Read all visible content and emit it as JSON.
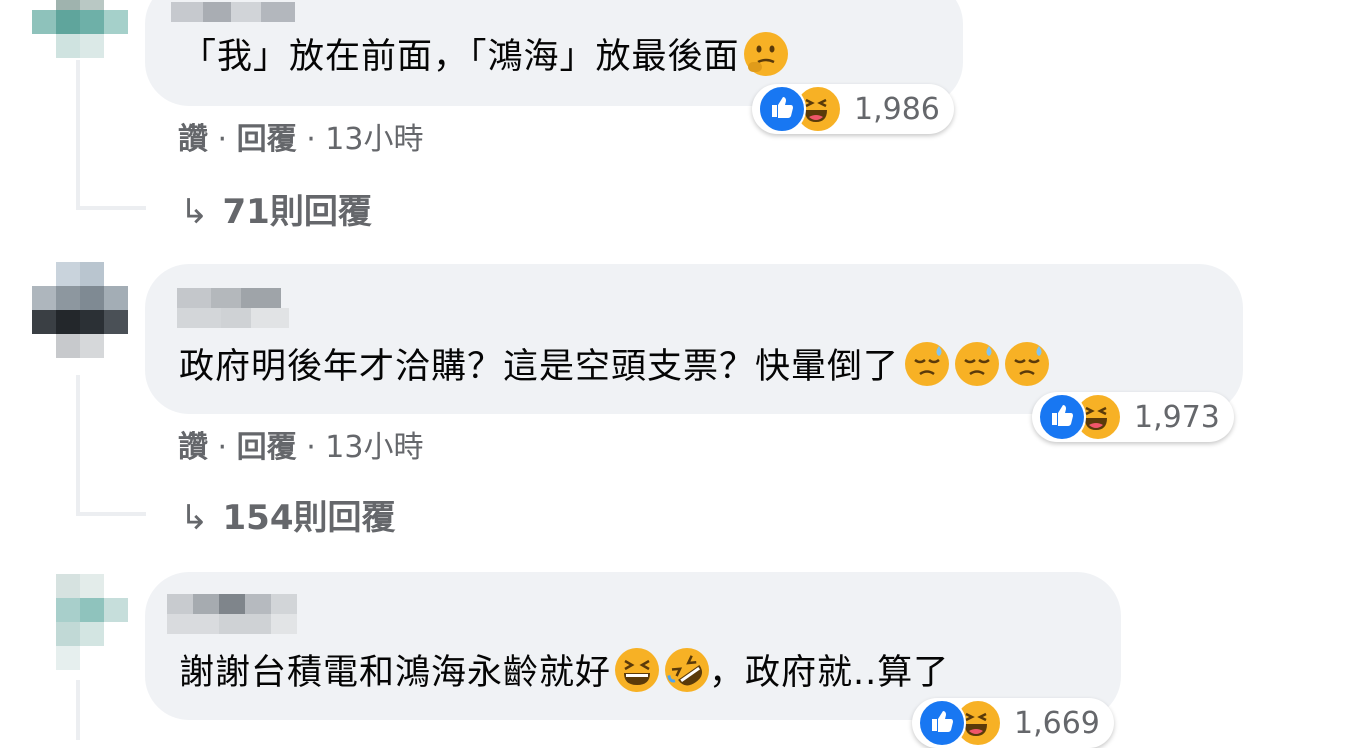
{
  "comments": [
    {
      "text": "「我」放在前面，「鴻海」放最後面",
      "emoji": [
        "thinking-face"
      ],
      "reactions": {
        "icons": [
          "like",
          "haha"
        ],
        "count": "1,986"
      },
      "meta": {
        "like": "讚",
        "sep1": "·",
        "reply": "回覆",
        "sep2": "·",
        "time": "13小時"
      },
      "replies": "71則回覆"
    },
    {
      "text": "政府明後年才洽購？這是空頭支票？快暈倒了",
      "emoji": [
        "sweat-face",
        "sweat-face",
        "sweat-face"
      ],
      "reactions": {
        "icons": [
          "like",
          "haha"
        ],
        "count": "1,973"
      },
      "meta": {
        "like": "讚",
        "sep1": "·",
        "reply": "回覆",
        "sep2": "·",
        "time": "13小時"
      },
      "replies": "154則回覆"
    },
    {
      "text_before": "謝謝台積電和鴻海永齡就好",
      "text_after": "，政府就..算了",
      "emoji": [
        "grinning-squint-face",
        "rolling-laughing-face"
      ],
      "reactions": {
        "icons": [
          "like",
          "haha"
        ],
        "count": "1,669"
      }
    }
  ],
  "replies_arrow": "↳",
  "colors": {
    "bubble": "#f0f2f5",
    "meta_text": "#65676b",
    "like_blue": "#1877f2",
    "emoji_yellow": "#f7b125"
  }
}
